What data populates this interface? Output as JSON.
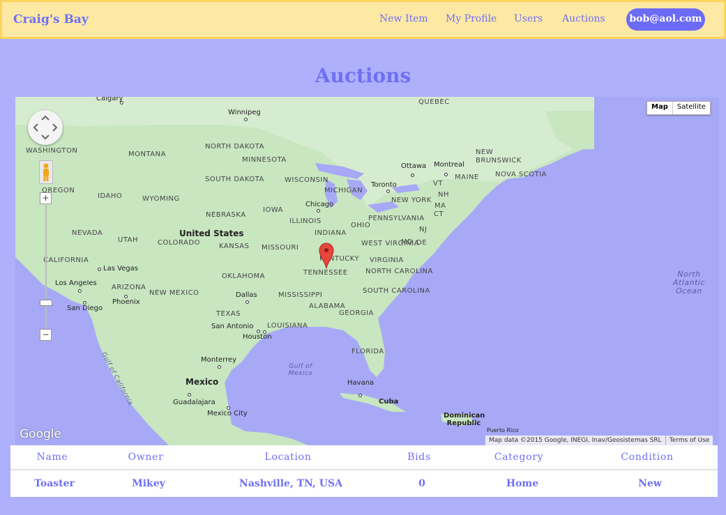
{
  "navbar": {
    "brand": "Craig's Bay",
    "links": [
      "New Item",
      "My Profile",
      "Users",
      "Auctions"
    ],
    "user_email": "bob@aol.com"
  },
  "page_title": "Auctions",
  "map": {
    "type_controls": [
      "Map",
      "Satellite"
    ],
    "country_labels": [
      "United States",
      "Mexico"
    ],
    "region_labels": [
      "QUEBEC",
      "WASHINGTON",
      "MONTANA",
      "NORTH DAKOTA",
      "MINNESOTA",
      "SOUTH DAKOTA",
      "WISCONSIN",
      "MICHIGAN",
      "OREGON",
      "IDAHO",
      "WYOMING",
      "NEBRASKA",
      "IOWA",
      "ILLINOIS",
      "INDIANA",
      "OHIO",
      "PENNSYLVANIA",
      "NEW YORK",
      "NEVADA",
      "UTAH",
      "COLORADO",
      "KANSAS",
      "MISSOURI",
      "KENTUCKY",
      "WEST VIRGINIA",
      "VIRGINIA",
      "CALIFORNIA",
      "ARIZONA",
      "NEW MEXICO",
      "OKLAHOMA",
      "TENNESSEE",
      "NORTH CAROLINA",
      "SOUTH CAROLINA",
      "TEXAS",
      "MISSISSIPPI",
      "ALABAMA",
      "GEORGIA",
      "LOUISIANA",
      "FLORIDA",
      "NEW BRUNSWICK",
      "NOVA SCOTIA",
      "MAINE",
      "VT",
      "NH",
      "MA",
      "CT",
      "NJ",
      "MD",
      "DE"
    ],
    "city_labels": [
      "Calgary",
      "Winnipeg",
      "Ottawa",
      "Montreal",
      "Toronto",
      "Chicago",
      "Las Vegas",
      "Los Angeles",
      "San Diego",
      "Phoenix",
      "Dallas",
      "San Antonio",
      "Houston",
      "Monterrey",
      "Guadalajara",
      "Mexico City",
      "Havana",
      "Cuba",
      "Dominican Republic",
      "Puerto Rico"
    ],
    "water_labels": [
      "North Atlantic Ocean",
      "Gulf of Mexico",
      "Gulf of California"
    ],
    "google_logo": "Google",
    "attribution": "Map data ©2015 Google, INEGI, Inav/Geosistemas SRL",
    "terms": "Terms of Use",
    "zoom_in": "+",
    "zoom_out": "−"
  },
  "table": {
    "headers": [
      "Name",
      "Owner",
      "Location",
      "Bids",
      "Category",
      "Condition"
    ],
    "rows": [
      [
        "Toaster",
        "Mikey",
        "Nashville, TN, USA",
        "0",
        "Home",
        "New"
      ]
    ]
  }
}
